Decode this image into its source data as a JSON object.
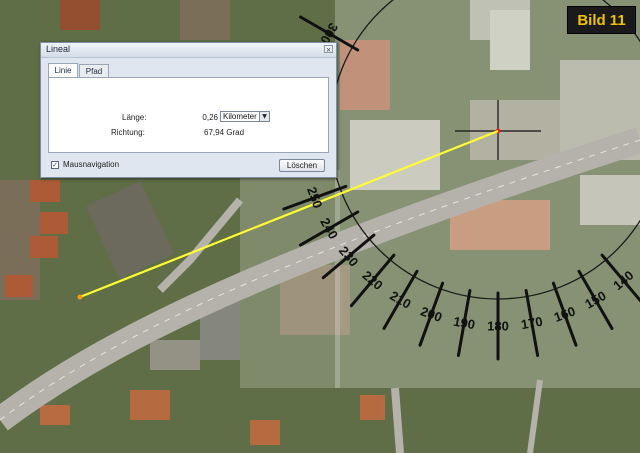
{
  "badge": {
    "label": "Bild 11"
  },
  "dialog": {
    "title": "Lineal",
    "close_glyph": "×",
    "tabs": [
      {
        "label": "Linie",
        "active": true
      },
      {
        "label": "Pfad",
        "active": false
      }
    ],
    "length_label": "Länge:",
    "length_value": "0,26",
    "unit_selected": "Kilometer",
    "direction_label": "Richtung:",
    "direction_value": "67,94 Grad",
    "mouse_nav_label": "Mausnavigation",
    "mouse_nav_checked": true,
    "delete_label": "Löschen"
  },
  "compass": {
    "labels": [
      "300",
      "250",
      "240",
      "230",
      "220",
      "210",
      "200",
      "190",
      "180",
      "170",
      "160",
      "150",
      "140"
    ]
  },
  "colors": {
    "measure_line": "#ffff33",
    "badge_text": "#f2c200",
    "badge_bg": "#1a1a1a"
  }
}
